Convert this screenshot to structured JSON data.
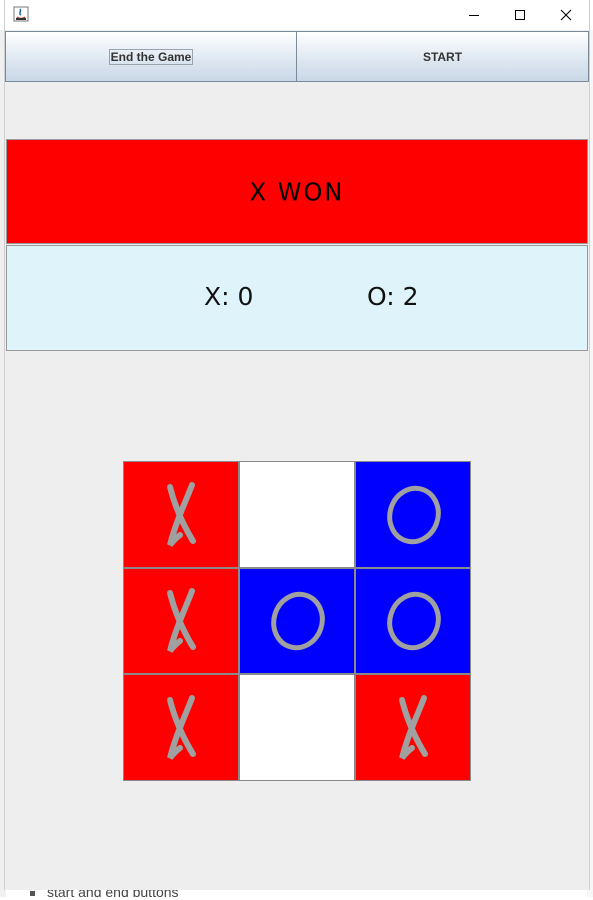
{
  "window": {
    "controls": [
      "minimize-icon",
      "maximize-icon",
      "close-icon"
    ]
  },
  "toolbar": {
    "end_label": "End the Game",
    "start_label": "START"
  },
  "status": {
    "text": "X WON",
    "color": "#ff0000"
  },
  "score": {
    "x_text": "X: 0",
    "o_text": "O: 2",
    "background": "#dff3fa"
  },
  "board": {
    "cells": [
      {
        "mark": "X",
        "color": "#ff0000"
      },
      {
        "mark": "",
        "color": "#ffffff"
      },
      {
        "mark": "O",
        "color": "#0000ff"
      },
      {
        "mark": "X",
        "color": "#ff0000"
      },
      {
        "mark": "O",
        "color": "#0000ff"
      },
      {
        "mark": "O",
        "color": "#0000ff"
      },
      {
        "mark": "X",
        "color": "#ff0000"
      },
      {
        "mark": "",
        "color": "#ffffff"
      },
      {
        "mark": "X",
        "color": "#ff0000"
      }
    ],
    "mark_color": "#a0a0a0"
  },
  "background_app": {
    "bottom_text": "start and end buttons"
  }
}
